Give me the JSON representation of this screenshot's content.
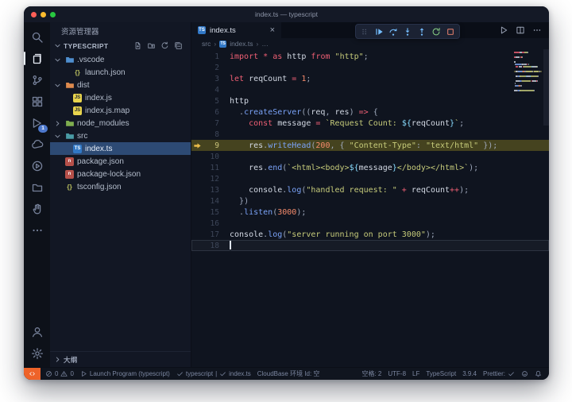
{
  "window": {
    "title": "index.ts — typescript"
  },
  "colors": {
    "accent": "#4d78cc",
    "badge": "#4d78cc",
    "remote": "#ee6329",
    "sel": "#2d4a74",
    "hl": "#45431f",
    "kw": "#ef5f74",
    "op": "#ef5f74",
    "str": "#c6cb7a",
    "fn": "#7aa2f7",
    "num": "#f78c6c",
    "pl": "#d2d8e3",
    "pn": "#9fa9bc",
    "ip": "#89ddff",
    "ts": "#3178c6",
    "js": "#e8d44d",
    "npm": "#b5504a",
    "json_braces": "#b8bd5e",
    "arrow_yellow": "#e9bb4a",
    "debug_blue": "#75beff",
    "debug_green": "#89d185",
    "debug_red": "#f48771"
  },
  "glyphs": {
    "ts": "TS",
    "js": "JS",
    "json": "{}",
    "npm": "n"
  },
  "activity_bar": {
    "items": [
      {
        "name": "search",
        "icon": "search-icon"
      },
      {
        "name": "explorer",
        "icon": "explorer-icon",
        "active": true
      },
      {
        "name": "source-control",
        "icon": "source-control-icon"
      },
      {
        "name": "extensions",
        "icon": "extensions-icon"
      },
      {
        "name": "run-debug",
        "icon": "debug-icon",
        "badge": "1"
      },
      {
        "name": "cloudbase",
        "icon": "cloud-icon"
      },
      {
        "name": "test",
        "icon": "play-circle-icon"
      },
      {
        "name": "workspace",
        "icon": "folder2-icon"
      },
      {
        "name": "hand",
        "icon": "hand-icon"
      },
      {
        "name": "more",
        "icon": "more-icon"
      }
    ],
    "bottom_items": [
      {
        "name": "account",
        "icon": "account-icon"
      },
      {
        "name": "settings",
        "icon": "gear-icon"
      }
    ]
  },
  "sidebar": {
    "title": "资源管理器",
    "section_label": "TYPESCRIPT",
    "actions": [
      {
        "name": "new-file",
        "icon": "new-file-icon"
      },
      {
        "name": "new-folder",
        "icon": "new-folder-icon"
      },
      {
        "name": "refresh",
        "icon": "refresh-icon"
      },
      {
        "name": "collapse-all",
        "icon": "collapse-all-icon"
      }
    ],
    "tree": [
      {
        "label": ".vscode",
        "icon": "folder",
        "color": "#4f8fd0",
        "chevron": "down",
        "indent": 0
      },
      {
        "label": "launch.json",
        "icon": "json",
        "indent": 1
      },
      {
        "label": "dist",
        "icon": "folder",
        "color": "#de8a4e",
        "chevron": "down",
        "indent": 0
      },
      {
        "label": "index.js",
        "icon": "js",
        "indent": 1
      },
      {
        "label": "index.js.map",
        "icon": "js",
        "indent": 1
      },
      {
        "label": "node_modules",
        "icon": "folder",
        "color": "#7fae4f",
        "chevron": "right",
        "indent": 0
      },
      {
        "label": "src",
        "icon": "folder",
        "color": "#4a9ba5",
        "chevron": "down",
        "indent": 0
      },
      {
        "label": "index.ts",
        "icon": "ts",
        "indent": 1,
        "selected": true
      },
      {
        "label": "package.json",
        "icon": "npm",
        "indent": 0
      },
      {
        "label": "package-lock.json",
        "icon": "npm",
        "indent": 0
      },
      {
        "label": "tsconfig.json",
        "icon": "json",
        "indent": 0
      }
    ],
    "outline_label": "大纲"
  },
  "editor": {
    "tab": {
      "label": "index.ts",
      "close": "×"
    },
    "breadcrumb": {
      "separator": "›",
      "items": [
        {
          "label": "src"
        },
        {
          "label": "index.ts",
          "icon": "ts"
        },
        {
          "label": "…"
        }
      ]
    },
    "debug_toolbar": [
      {
        "name": "continue",
        "icon": "debug-continue-icon",
        "color": "blue"
      },
      {
        "name": "step-over",
        "icon": "debug-step-over-icon",
        "color": "blue"
      },
      {
        "name": "step-into",
        "icon": "debug-step-into-icon",
        "color": "blue"
      },
      {
        "name": "step-out",
        "icon": "debug-step-out-icon",
        "color": "blue"
      },
      {
        "name": "restart",
        "icon": "debug-restart-icon",
        "color": "green"
      },
      {
        "name": "stop",
        "icon": "debug-stop-icon",
        "color": "red"
      }
    ],
    "actions": [
      {
        "name": "run",
        "icon": "run-icon"
      },
      {
        "name": "split-editor",
        "icon": "split-editor-icon"
      },
      {
        "name": "more-actions",
        "icon": "more-h-icon"
      }
    ],
    "debug_line": 9,
    "cursor_line": 18,
    "lines": [
      {
        "n": 1,
        "t": [
          [
            "kw",
            "import"
          ],
          [
            "ws",
            " "
          ],
          [
            "op",
            "*"
          ],
          [
            "ws",
            " "
          ],
          [
            "kw",
            "as"
          ],
          [
            "ws",
            " "
          ],
          [
            "pl",
            "http"
          ],
          [
            "ws",
            " "
          ],
          [
            "kw",
            "from"
          ],
          [
            "ws",
            " "
          ],
          [
            "str",
            "\"http\""
          ],
          [
            "pn",
            ";"
          ]
        ]
      },
      {
        "n": 2,
        "t": []
      },
      {
        "n": 3,
        "t": [
          [
            "kw",
            "let"
          ],
          [
            "ws",
            " "
          ],
          [
            "pl",
            "reqCount"
          ],
          [
            "ws",
            " "
          ],
          [
            "op",
            "="
          ],
          [
            "ws",
            " "
          ],
          [
            "num",
            "1"
          ],
          [
            "pn",
            ";"
          ]
        ]
      },
      {
        "n": 4,
        "t": []
      },
      {
        "n": 5,
        "t": [
          [
            "pl",
            "http"
          ]
        ]
      },
      {
        "n": 6,
        "t": [
          [
            "ws",
            "  "
          ],
          [
            "pn",
            "."
          ],
          [
            "fn",
            "createServer"
          ],
          [
            "pn",
            "(("
          ],
          [
            "pl",
            "req"
          ],
          [
            "pn",
            ","
          ],
          [
            "ws",
            " "
          ],
          [
            "pl",
            "res"
          ],
          [
            "pn",
            ")"
          ],
          [
            "ws",
            " "
          ],
          [
            "op",
            "=>"
          ],
          [
            "ws",
            " "
          ],
          [
            "pn",
            "{"
          ]
        ]
      },
      {
        "n": 7,
        "t": [
          [
            "ws",
            "    "
          ],
          [
            "kw",
            "const"
          ],
          [
            "ws",
            " "
          ],
          [
            "pl",
            "message"
          ],
          [
            "ws",
            " "
          ],
          [
            "op",
            "="
          ],
          [
            "ws",
            " "
          ],
          [
            "str",
            "`Request Count: "
          ],
          [
            "ip",
            "${"
          ],
          [
            "pl",
            "reqCount"
          ],
          [
            "ip",
            "}"
          ],
          [
            "str",
            "`"
          ],
          [
            "pn",
            ";"
          ]
        ]
      },
      {
        "n": 8,
        "t": []
      },
      {
        "n": 9,
        "t": [
          [
            "ws",
            "    "
          ],
          [
            "pl",
            "res"
          ],
          [
            "pn",
            "."
          ],
          [
            "fn",
            "writeHead"
          ],
          [
            "pn",
            "("
          ],
          [
            "num",
            "200"
          ],
          [
            "pn",
            ","
          ],
          [
            "ws",
            " "
          ],
          [
            "pn",
            "{"
          ],
          [
            "ws",
            " "
          ],
          [
            "str",
            "\"Content-Type\""
          ],
          [
            "pn",
            ":"
          ],
          [
            "ws",
            " "
          ],
          [
            "str",
            "\"text/html\""
          ],
          [
            "ws",
            " "
          ],
          [
            "pn",
            "}"
          ],
          [
            "pn",
            ");"
          ]
        ]
      },
      {
        "n": 10,
        "t": []
      },
      {
        "n": 11,
        "t": [
          [
            "ws",
            "    "
          ],
          [
            "pl",
            "res"
          ],
          [
            "pn",
            "."
          ],
          [
            "fn",
            "end"
          ],
          [
            "pn",
            "("
          ],
          [
            "str",
            "`<html><body>"
          ],
          [
            "ip",
            "${"
          ],
          [
            "pl",
            "message"
          ],
          [
            "ip",
            "}"
          ],
          [
            "str",
            "</body></html>`"
          ],
          [
            "pn",
            ");"
          ]
        ]
      },
      {
        "n": 12,
        "t": []
      },
      {
        "n": 13,
        "t": [
          [
            "ws",
            "    "
          ],
          [
            "pl",
            "console"
          ],
          [
            "pn",
            "."
          ],
          [
            "fn",
            "log"
          ],
          [
            "pn",
            "("
          ],
          [
            "str",
            "\"handled request: \""
          ],
          [
            "ws",
            " "
          ],
          [
            "op",
            "+"
          ],
          [
            "ws",
            " "
          ],
          [
            "pl",
            "reqCount"
          ],
          [
            "op",
            "++"
          ],
          [
            "pn",
            ");"
          ]
        ]
      },
      {
        "n": 14,
        "t": [
          [
            "ws",
            "  "
          ],
          [
            "pn",
            "})"
          ]
        ]
      },
      {
        "n": 15,
        "t": [
          [
            "ws",
            "  "
          ],
          [
            "pn",
            "."
          ],
          [
            "fn",
            "listen"
          ],
          [
            "pn",
            "("
          ],
          [
            "num",
            "3000"
          ],
          [
            "pn",
            ");"
          ]
        ]
      },
      {
        "n": 16,
        "t": []
      },
      {
        "n": 17,
        "t": [
          [
            "pl",
            "console"
          ],
          [
            "pn",
            "."
          ],
          [
            "fn",
            "log"
          ],
          [
            "pn",
            "("
          ],
          [
            "str",
            "\"server running on port 3000\""
          ],
          [
            "pn",
            ");"
          ]
        ]
      },
      {
        "n": 18,
        "t": []
      }
    ]
  },
  "status_bar": {
    "left": [
      {
        "name": "remote",
        "accent": true,
        "segs": [
          {
            "icon": "remote-icon"
          }
        ]
      },
      {
        "name": "problems",
        "segs": [
          {
            "icon": "error-icon"
          },
          {
            "text": "0"
          },
          {
            "icon": "warning-icon"
          },
          {
            "text": "0"
          }
        ]
      },
      {
        "name": "debug-launch",
        "segs": [
          {
            "icon": "play-outline-icon"
          },
          {
            "text": "Launch Program (typescript)"
          }
        ]
      },
      {
        "name": "lang-status",
        "segs": [
          {
            "icon": "check-icon"
          },
          {
            "text": "typescript"
          },
          {
            "text": "|"
          },
          {
            "icon": "check-icon"
          },
          {
            "text": "index.ts"
          }
        ]
      },
      {
        "name": "cloudbase-env",
        "segs": [
          {
            "text": "CloudBase 环境 Id: 空"
          }
        ]
      }
    ],
    "right": [
      {
        "name": "indentation",
        "segs": [
          {
            "text": "空格: 2"
          }
        ]
      },
      {
        "name": "encoding",
        "segs": [
          {
            "text": "UTF-8"
          }
        ]
      },
      {
        "name": "eol",
        "segs": [
          {
            "text": "LF"
          }
        ]
      },
      {
        "name": "language",
        "segs": [
          {
            "text": "TypeScript"
          }
        ]
      },
      {
        "name": "ts-version",
        "segs": [
          {
            "text": "3.9.4"
          }
        ]
      },
      {
        "name": "prettier",
        "segs": [
          {
            "text": "Prettier:"
          },
          {
            "icon": "check-icon"
          }
        ]
      },
      {
        "name": "feedback",
        "segs": [
          {
            "icon": "feedback-icon"
          }
        ]
      },
      {
        "name": "notifications",
        "segs": [
          {
            "icon": "bell-icon"
          }
        ]
      }
    ]
  }
}
